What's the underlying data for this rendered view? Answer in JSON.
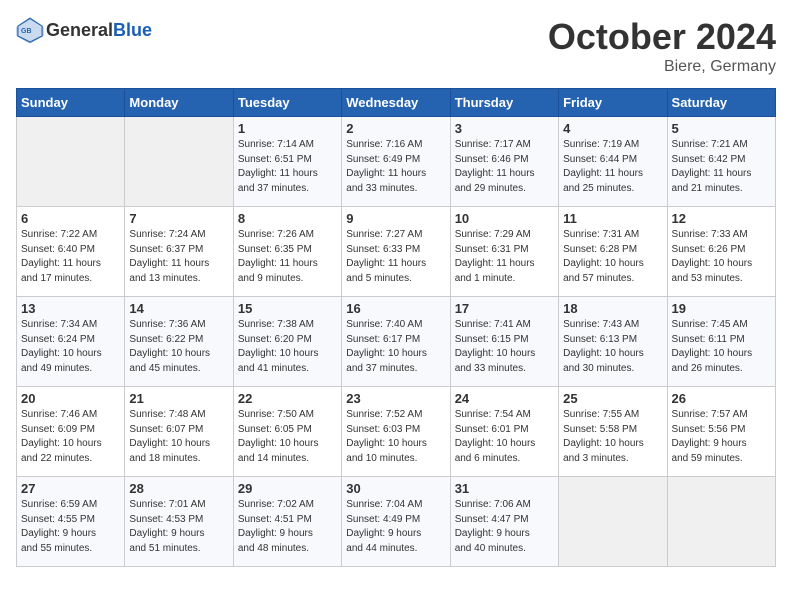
{
  "header": {
    "logo_general": "General",
    "logo_blue": "Blue",
    "title": "October 2024",
    "location": "Biere, Germany"
  },
  "days_of_week": [
    "Sunday",
    "Monday",
    "Tuesday",
    "Wednesday",
    "Thursday",
    "Friday",
    "Saturday"
  ],
  "weeks": [
    [
      {
        "day": "",
        "info": ""
      },
      {
        "day": "",
        "info": ""
      },
      {
        "day": "1",
        "info": "Sunrise: 7:14 AM\nSunset: 6:51 PM\nDaylight: 11 hours\nand 37 minutes."
      },
      {
        "day": "2",
        "info": "Sunrise: 7:16 AM\nSunset: 6:49 PM\nDaylight: 11 hours\nand 33 minutes."
      },
      {
        "day": "3",
        "info": "Sunrise: 7:17 AM\nSunset: 6:46 PM\nDaylight: 11 hours\nand 29 minutes."
      },
      {
        "day": "4",
        "info": "Sunrise: 7:19 AM\nSunset: 6:44 PM\nDaylight: 11 hours\nand 25 minutes."
      },
      {
        "day": "5",
        "info": "Sunrise: 7:21 AM\nSunset: 6:42 PM\nDaylight: 11 hours\nand 21 minutes."
      }
    ],
    [
      {
        "day": "6",
        "info": "Sunrise: 7:22 AM\nSunset: 6:40 PM\nDaylight: 11 hours\nand 17 minutes."
      },
      {
        "day": "7",
        "info": "Sunrise: 7:24 AM\nSunset: 6:37 PM\nDaylight: 11 hours\nand 13 minutes."
      },
      {
        "day": "8",
        "info": "Sunrise: 7:26 AM\nSunset: 6:35 PM\nDaylight: 11 hours\nand 9 minutes."
      },
      {
        "day": "9",
        "info": "Sunrise: 7:27 AM\nSunset: 6:33 PM\nDaylight: 11 hours\nand 5 minutes."
      },
      {
        "day": "10",
        "info": "Sunrise: 7:29 AM\nSunset: 6:31 PM\nDaylight: 11 hours\nand 1 minute."
      },
      {
        "day": "11",
        "info": "Sunrise: 7:31 AM\nSunset: 6:28 PM\nDaylight: 10 hours\nand 57 minutes."
      },
      {
        "day": "12",
        "info": "Sunrise: 7:33 AM\nSunset: 6:26 PM\nDaylight: 10 hours\nand 53 minutes."
      }
    ],
    [
      {
        "day": "13",
        "info": "Sunrise: 7:34 AM\nSunset: 6:24 PM\nDaylight: 10 hours\nand 49 minutes."
      },
      {
        "day": "14",
        "info": "Sunrise: 7:36 AM\nSunset: 6:22 PM\nDaylight: 10 hours\nand 45 minutes."
      },
      {
        "day": "15",
        "info": "Sunrise: 7:38 AM\nSunset: 6:20 PM\nDaylight: 10 hours\nand 41 minutes."
      },
      {
        "day": "16",
        "info": "Sunrise: 7:40 AM\nSunset: 6:17 PM\nDaylight: 10 hours\nand 37 minutes."
      },
      {
        "day": "17",
        "info": "Sunrise: 7:41 AM\nSunset: 6:15 PM\nDaylight: 10 hours\nand 33 minutes."
      },
      {
        "day": "18",
        "info": "Sunrise: 7:43 AM\nSunset: 6:13 PM\nDaylight: 10 hours\nand 30 minutes."
      },
      {
        "day": "19",
        "info": "Sunrise: 7:45 AM\nSunset: 6:11 PM\nDaylight: 10 hours\nand 26 minutes."
      }
    ],
    [
      {
        "day": "20",
        "info": "Sunrise: 7:46 AM\nSunset: 6:09 PM\nDaylight: 10 hours\nand 22 minutes."
      },
      {
        "day": "21",
        "info": "Sunrise: 7:48 AM\nSunset: 6:07 PM\nDaylight: 10 hours\nand 18 minutes."
      },
      {
        "day": "22",
        "info": "Sunrise: 7:50 AM\nSunset: 6:05 PM\nDaylight: 10 hours\nand 14 minutes."
      },
      {
        "day": "23",
        "info": "Sunrise: 7:52 AM\nSunset: 6:03 PM\nDaylight: 10 hours\nand 10 minutes."
      },
      {
        "day": "24",
        "info": "Sunrise: 7:54 AM\nSunset: 6:01 PM\nDaylight: 10 hours\nand 6 minutes."
      },
      {
        "day": "25",
        "info": "Sunrise: 7:55 AM\nSunset: 5:58 PM\nDaylight: 10 hours\nand 3 minutes."
      },
      {
        "day": "26",
        "info": "Sunrise: 7:57 AM\nSunset: 5:56 PM\nDaylight: 9 hours\nand 59 minutes."
      }
    ],
    [
      {
        "day": "27",
        "info": "Sunrise: 6:59 AM\nSunset: 4:55 PM\nDaylight: 9 hours\nand 55 minutes."
      },
      {
        "day": "28",
        "info": "Sunrise: 7:01 AM\nSunset: 4:53 PM\nDaylight: 9 hours\nand 51 minutes."
      },
      {
        "day": "29",
        "info": "Sunrise: 7:02 AM\nSunset: 4:51 PM\nDaylight: 9 hours\nand 48 minutes."
      },
      {
        "day": "30",
        "info": "Sunrise: 7:04 AM\nSunset: 4:49 PM\nDaylight: 9 hours\nand 44 minutes."
      },
      {
        "day": "31",
        "info": "Sunrise: 7:06 AM\nSunset: 4:47 PM\nDaylight: 9 hours\nand 40 minutes."
      },
      {
        "day": "",
        "info": ""
      },
      {
        "day": "",
        "info": ""
      }
    ]
  ]
}
